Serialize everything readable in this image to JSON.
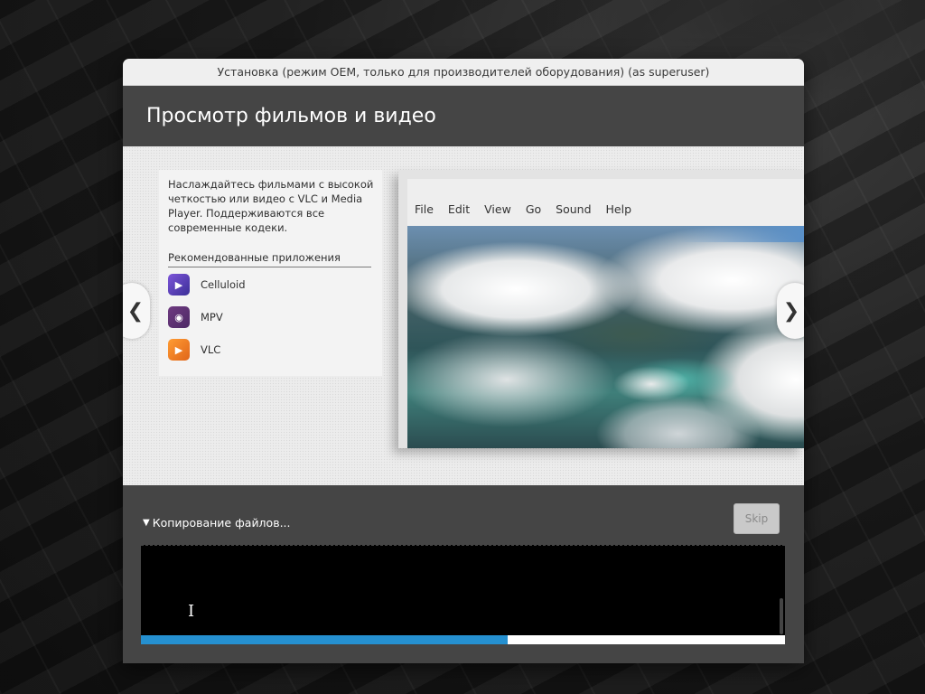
{
  "window": {
    "title": "Установка (режим OEM, только для производителей оборудования) (as superuser)"
  },
  "header": {
    "title": "Просмотр фильмов и видео"
  },
  "slide": {
    "description": "Наслаждайтесь фильмами с высокой четкостью или видео с VLC и Media Player. Поддерживаются все современные кодеки.",
    "recommended_label": "Рекомендованные приложения",
    "apps": [
      {
        "name": "Celluloid",
        "icon": "celluloid-icon"
      },
      {
        "name": "MPV",
        "icon": "mpv-icon"
      },
      {
        "name": "VLC",
        "icon": "vlc-icon"
      }
    ],
    "screenshot_menu": [
      "File",
      "Edit",
      "View",
      "Go",
      "Sound",
      "Help"
    ]
  },
  "progress": {
    "status": "Копирование файлов...",
    "skip_label": "Skip",
    "fraction": 0.57
  },
  "colors": {
    "progress_fill": "#2590d0",
    "header_bg": "#454545"
  }
}
